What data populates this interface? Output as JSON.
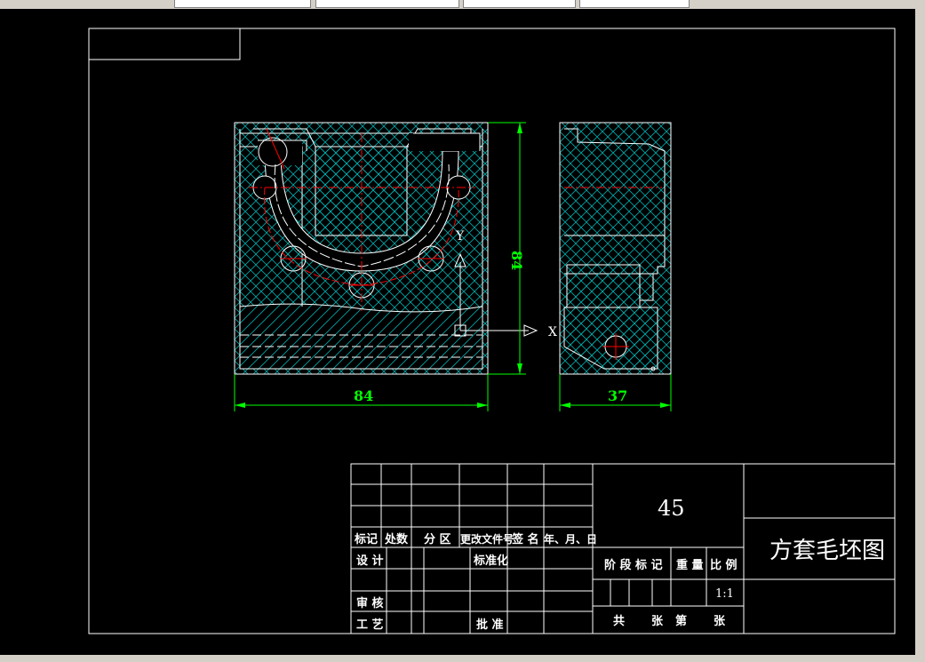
{
  "colors": {
    "background": "#000000",
    "line": "#ffffff",
    "dimension": "#00ff00",
    "centerline": "#ff0000",
    "hatch": "#00aaaa"
  },
  "dimensions": {
    "front_height": "84",
    "front_width": "84",
    "side_width": "37"
  },
  "axes": {
    "y_label": "Y",
    "x_label": "X"
  },
  "title_block": {
    "material": "45",
    "drawing_title": "方套毛坯图",
    "scale": "1:1",
    "headers": {
      "mark": "标记",
      "count": "处数",
      "zone": "分 区",
      "change_doc": "更改文件号",
      "signature": "签 名",
      "date": "年、月、日"
    },
    "labels": {
      "design": "设 计",
      "standardize": "标准化",
      "review": "审 核",
      "process": "工 艺",
      "approve": "批 准",
      "stage_mark": "阶 段 标 记",
      "weight": "重 量",
      "scale_label": "比 例",
      "total": "共",
      "sheets1": "张",
      "sheet_no": "第",
      "sheets2": "张"
    }
  }
}
